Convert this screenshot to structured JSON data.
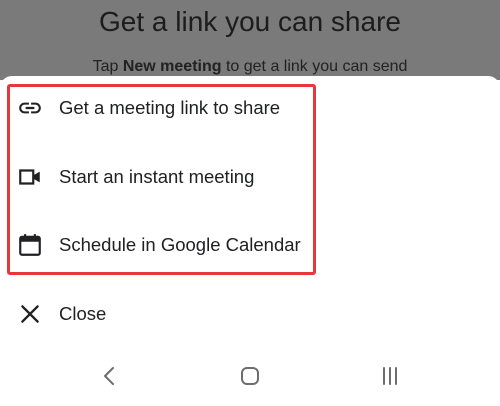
{
  "background": {
    "title": "Get a link you can share",
    "subtitle_prefix": "Tap ",
    "subtitle_bold": "New meeting",
    "subtitle_suffix": " to get a link you can send"
  },
  "sheet": {
    "items": [
      {
        "label": "Get a meeting link to share",
        "icon": "link-icon"
      },
      {
        "label": "Start an instant meeting",
        "icon": "video-camera-icon"
      },
      {
        "label": "Schedule in Google Calendar",
        "icon": "calendar-icon"
      }
    ],
    "close_label": "Close",
    "close_icon": "close-icon"
  },
  "navbar": {
    "back_icon": "back-icon",
    "home_icon": "home-icon",
    "recents_icon": "recents-icon"
  },
  "colors": {
    "highlight": "#e5373c",
    "text": "#202124",
    "scrim": "#7a7a7a"
  }
}
